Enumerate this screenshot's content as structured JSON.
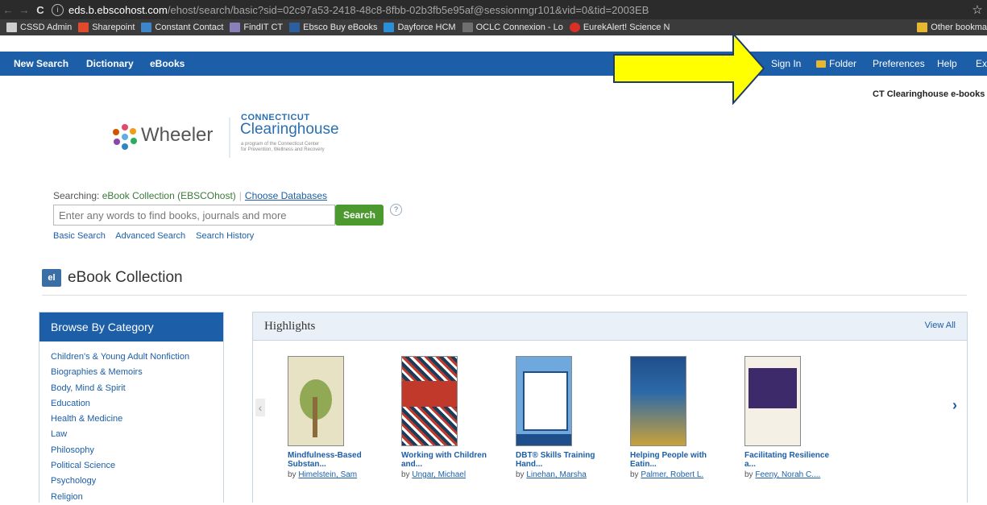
{
  "browser": {
    "url_host": "eds.b.ebscohost.com",
    "url_path": "/ehost/search/basic?sid=02c97a53-2418-48c8-8fbb-02b3fb5e95af@sessionmgr101&vid=0&tid=2003EB",
    "bookmarks": [
      {
        "label": "CSSD Admin",
        "icon": "page-icon",
        "color": "#cfcfcf"
      },
      {
        "label": "Sharepoint",
        "icon": "sharepoint-icon",
        "color": "#e24a2b"
      },
      {
        "label": "Constant Contact",
        "icon": "constant-contact-icon",
        "color": "#3c86c9"
      },
      {
        "label": "FindIT CT",
        "icon": "findit-icon",
        "color": "#8a7fb8"
      },
      {
        "label": "Ebsco Buy eBooks",
        "icon": "ebsco-icon",
        "color": "#2b5f9e"
      },
      {
        "label": "Dayforce HCM",
        "icon": "dayforce-icon",
        "color": "#2a8fd6"
      },
      {
        "label": "OCLC Connexion - Lo",
        "icon": "oclc-icon",
        "color": "#6f6f6f"
      },
      {
        "label": "EurekAlert! Science N",
        "icon": "eurekalert-icon",
        "color": "#d93025"
      }
    ],
    "other_bookmarks": "Other bookma"
  },
  "toolbar": {
    "new_search": "New Search",
    "dictionary": "Dictionary",
    "ebooks": "eBooks",
    "sign_in": "Sign In",
    "folder": "Folder",
    "preferences": "Preferences",
    "help": "Help",
    "exit": "Ex"
  },
  "profile_label": "CT Clearinghouse e-books",
  "logo": {
    "wheeler": "Wheeler",
    "connecticut": "CONNECTICUT",
    "clearinghouse": "Clearinghouse",
    "tagline1": "a program of the Connecticut Center",
    "tagline2": "for Prevention, Wellness and Recovery"
  },
  "search": {
    "searching_label": "Searching:",
    "collection": "eBook Collection (EBSCOhost)",
    "choose_databases": "Choose Databases",
    "placeholder": "Enter any words to find books, journals and more",
    "button": "Search",
    "links": [
      "Basic Search",
      "Advanced Search",
      "Search History"
    ]
  },
  "collection_title": "eBook Collection",
  "browse": {
    "title": "Browse By Category",
    "categories": [
      "Children's & Young Adult Nonfiction",
      "Biographies & Memoirs",
      "Body, Mind & Spirit",
      "Education",
      "Health & Medicine",
      "Law",
      "Philosophy",
      "Political Science",
      "Psychology",
      "Religion"
    ]
  },
  "highlights": {
    "title": "Highlights",
    "view_all": "View All",
    "books": [
      {
        "title1": "Mindfulness-Based",
        "title2": "Substan...",
        "author": "Himelstein, Sam",
        "cover": "#e8e2c4"
      },
      {
        "title1": "Working with Children",
        "title2": "and...",
        "author": "Ungar, Michael",
        "cover": "#c0392b"
      },
      {
        "title1": "DBT® Skills Training",
        "title2": "Hand...",
        "author": "Linehan, Marsha",
        "cover": "#6fa8dc"
      },
      {
        "title1": "Helping People with",
        "title2": "Eatin...",
        "author": "Palmer, Robert L.",
        "cover": "#1f4e8c"
      },
      {
        "title1": "Facilitating Resilience",
        "title2": "a...",
        "author": "Feeny, Norah C....",
        "cover": "#3d2a6b"
      }
    ]
  },
  "colors": {
    "toolbar": "#1c5ea8",
    "search_button": "#4c9a2f",
    "arrow": "#ffff00"
  }
}
